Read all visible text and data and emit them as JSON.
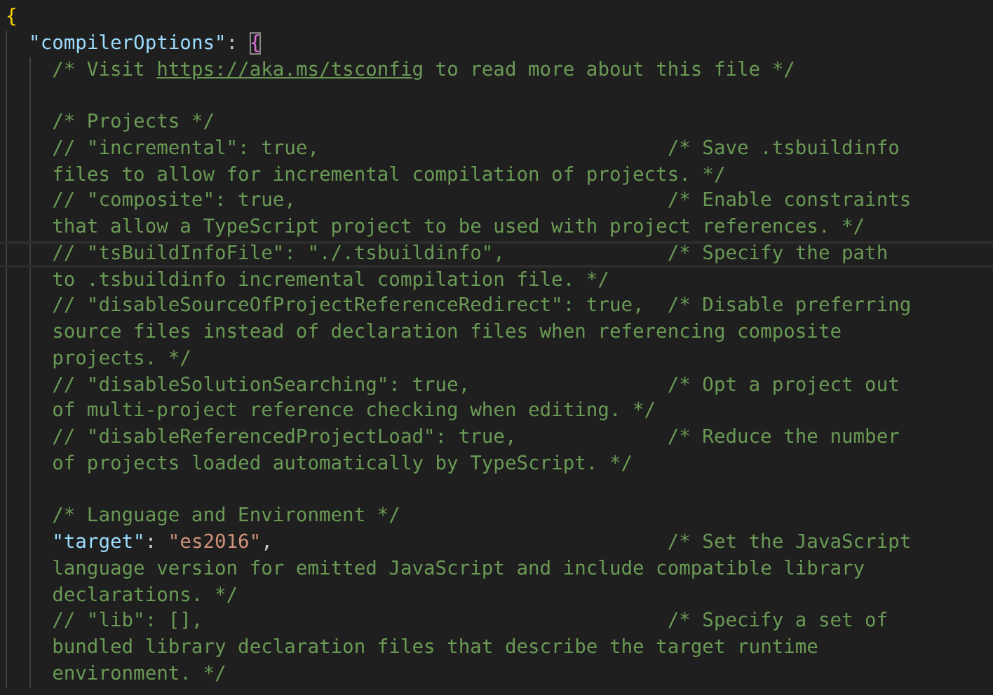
{
  "editor": {
    "lines": [
      {
        "kind": "line",
        "segments": [
          {
            "kind": "bracket",
            "text": "{",
            "color": "#ffd700",
            "matched": false
          }
        ],
        "children": [
          {
            "kind": "line",
            "segments": [
              {
                "kind": "key",
                "text": "\"compilerOptions\""
              },
              {
                "kind": "punct",
                "text": ": "
              },
              {
                "kind": "bracket",
                "text": "{",
                "color": "#da70d6",
                "matched": true
              }
            ],
            "children": [
              {
                "kind": "line",
                "segments": [
                  {
                    "kind": "comment",
                    "text": "/* Visit "
                  },
                  {
                    "kind": "link",
                    "text": "https://aka.ms/tsconfig"
                  },
                  {
                    "kind": "comment",
                    "text": " to read more about this file */"
                  }
                ]
              },
              {
                "kind": "blank"
              },
              {
                "kind": "line",
                "segments": [
                  {
                    "kind": "comment",
                    "text": "/* Projects */"
                  }
                ]
              },
              {
                "kind": "line",
                "segments": [
                  {
                    "kind": "comment",
                    "text": "// \"incremental\": true,"
                  }
                ],
                "comment": "/* Save .tsbuildinfo"
              },
              {
                "kind": "wrap",
                "comment": "files to allow for incremental compilation of projects. */"
              },
              {
                "kind": "line",
                "segments": [
                  {
                    "kind": "comment",
                    "text": "// \"composite\": true,"
                  }
                ],
                "comment": "/* Enable constraints"
              },
              {
                "kind": "wrap",
                "comment": "that allow a TypeScript project to be used with project references. */"
              },
              {
                "kind": "line",
                "current": true,
                "segments": [
                  {
                    "kind": "comment",
                    "text": "// \"tsBuildInfoFile\": \"./.tsbuildinfo\","
                  }
                ],
                "comment": "/* Specify the path"
              },
              {
                "kind": "wrap",
                "comment": "to .tsbuildinfo incremental compilation file. */"
              },
              {
                "kind": "line",
                "segments": [
                  {
                    "kind": "comment",
                    "text": "// \"disableSourceOfProjectReferenceRedirect\": true,"
                  }
                ],
                "comment": "/* Disable preferring"
              },
              {
                "kind": "wrap",
                "comment": "source files instead of declaration files when referencing composite"
              },
              {
                "kind": "wrap",
                "comment": "projects. */"
              },
              {
                "kind": "line",
                "segments": [
                  {
                    "kind": "comment",
                    "text": "// \"disableSolutionSearching\": true,"
                  }
                ],
                "comment": "/* Opt a project out"
              },
              {
                "kind": "wrap",
                "comment": "of multi-project reference checking when editing. */"
              },
              {
                "kind": "line",
                "segments": [
                  {
                    "kind": "comment",
                    "text": "// \"disableReferencedProjectLoad\": true,"
                  }
                ],
                "comment": "/* Reduce the number"
              },
              {
                "kind": "wrap",
                "comment": "of projects loaded automatically by TypeScript. */"
              },
              {
                "kind": "blank"
              },
              {
                "kind": "line",
                "segments": [
                  {
                    "kind": "comment",
                    "text": "/* Language and Environment */"
                  }
                ]
              },
              {
                "kind": "line",
                "segments": [
                  {
                    "kind": "key",
                    "text": "\"target\""
                  },
                  {
                    "kind": "punct",
                    "text": ": "
                  },
                  {
                    "kind": "string",
                    "text": "\"es2016\""
                  },
                  {
                    "kind": "punct",
                    "text": ","
                  }
                ],
                "comment": "/* Set the JavaScript"
              },
              {
                "kind": "wrap",
                "comment": "language version for emitted JavaScript and include compatible library"
              },
              {
                "kind": "wrap",
                "comment": "declarations. */"
              },
              {
                "kind": "line",
                "segments": [
                  {
                    "kind": "comment",
                    "text": "// \"lib\": [],"
                  }
                ],
                "comment": "/* Specify a set of"
              },
              {
                "kind": "wrap",
                "comment": "bundled library declaration files that describe the target runtime"
              },
              {
                "kind": "wrap",
                "comment": "environment. */"
              }
            ]
          }
        ]
      }
    ]
  }
}
